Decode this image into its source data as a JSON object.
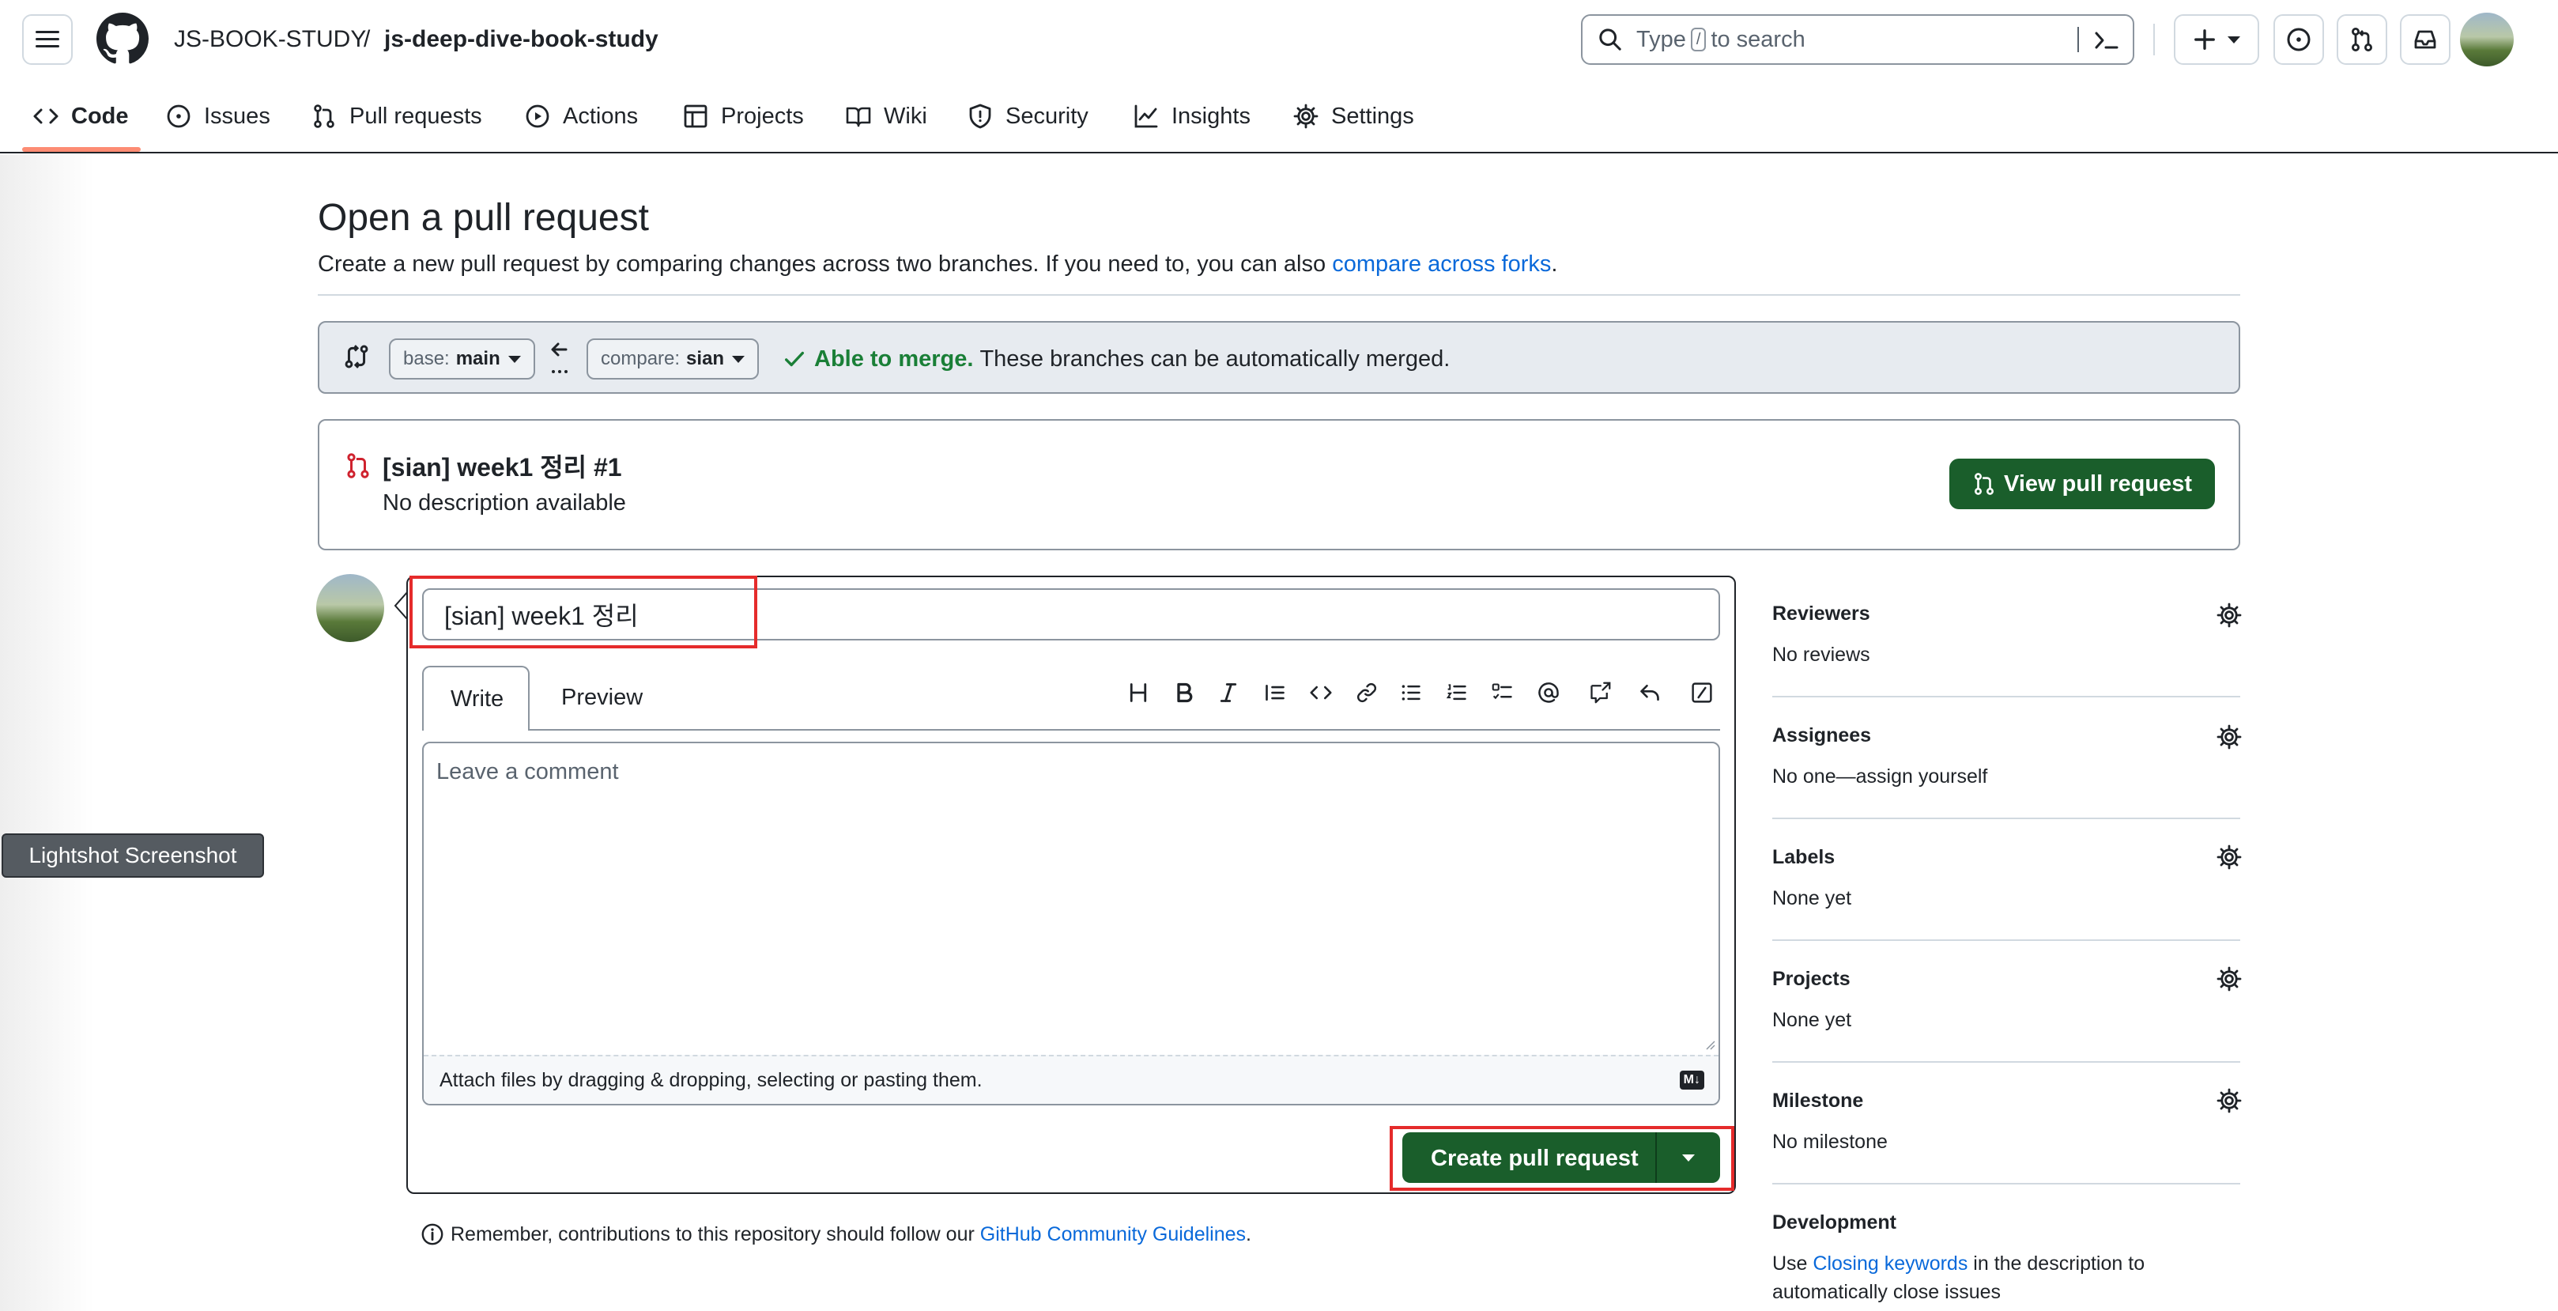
{
  "header": {
    "org": "JS-BOOK-STUDY",
    "separator": "/",
    "repo": "js-deep-dive-book-study",
    "search_before": "Type",
    "search_key": "/",
    "search_after": "to search"
  },
  "nav": {
    "tabs": [
      {
        "label": "Code"
      },
      {
        "label": "Issues"
      },
      {
        "label": "Pull requests"
      },
      {
        "label": "Actions"
      },
      {
        "label": "Projects"
      },
      {
        "label": "Wiki"
      },
      {
        "label": "Security"
      },
      {
        "label": "Insights"
      },
      {
        "label": "Settings"
      }
    ]
  },
  "page": {
    "title": "Open a pull request",
    "subtitle_before": "Create a new pull request by comparing changes across two branches. If you need to, you can also",
    "subtitle_link": "compare across forks",
    "subtitle_after": "."
  },
  "compare": {
    "base_label": "base:",
    "base_value": "main",
    "compare_label": "compare:",
    "compare_value": "sian",
    "merge_status": "Able to merge.",
    "merge_text": "These branches can be automatically merged."
  },
  "existing_pr": {
    "title": "[sian] week1 정리 #1",
    "description": "No description available",
    "button": "View pull request"
  },
  "editor": {
    "title_value": "[sian] week1 정리",
    "tab_write": "Write",
    "tab_preview": "Preview",
    "comment_placeholder": "Leave a comment",
    "attach_text": "Attach files by dragging & dropping, selecting or pasting them.",
    "markdown_badge": "M↓",
    "create_button": "Create pull request"
  },
  "footer": {
    "note_before": "Remember, contributions to this repository should follow our",
    "note_link": "GitHub Community Guidelines",
    "note_after": "."
  },
  "sidebar": {
    "sections": [
      {
        "heading": "Reviewers",
        "value": "No reviews"
      },
      {
        "heading": "Assignees",
        "value": "No one—assign yourself"
      },
      {
        "heading": "Labels",
        "value": "None yet"
      },
      {
        "heading": "Projects",
        "value": "None yet"
      },
      {
        "heading": "Milestone",
        "value": "No milestone"
      }
    ],
    "development": {
      "heading": "Development",
      "before": "Use",
      "link": "Closing keywords",
      "after_line1": "in the description to",
      "line2": "automatically close issues"
    }
  },
  "overlay": {
    "lightshot": "Lightshot Screenshot"
  },
  "colors": {
    "accent": "#0969da",
    "primary_button": "#1a5e2b",
    "annotation_red": "#e52b2b",
    "merge_green": "#1a7f37"
  }
}
